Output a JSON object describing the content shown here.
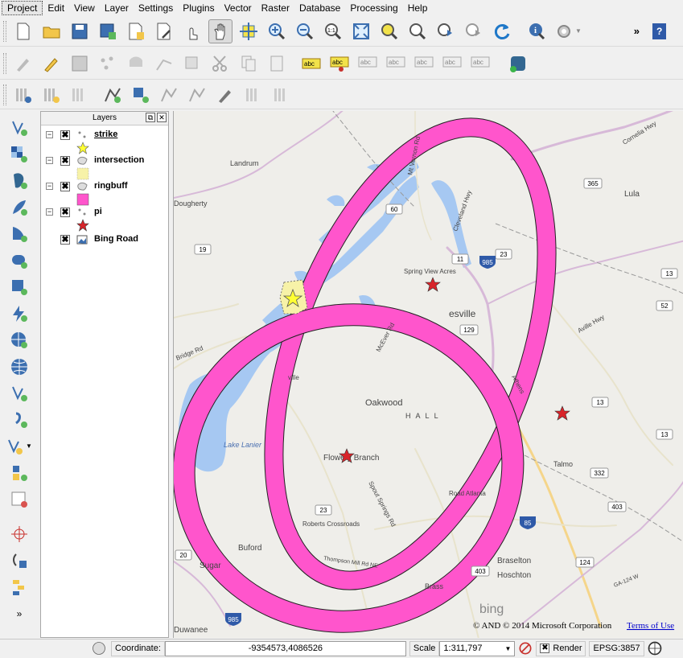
{
  "menu": [
    "Project",
    "Edit",
    "View",
    "Layer",
    "Settings",
    "Plugins",
    "Vector",
    "Raster",
    "Database",
    "Processing",
    "Help"
  ],
  "toolbar": {
    "overflow_label": "»"
  },
  "layers_panel": {
    "title": "Layers",
    "layers": [
      {
        "name": "strike",
        "checked": "✖",
        "expanded": "−",
        "symbol": "yellow-star"
      },
      {
        "name": "intersection",
        "checked": "✖",
        "expanded": "−",
        "symbol": "light-yellow-polygon"
      },
      {
        "name": "ringbuff",
        "checked": "✖",
        "expanded": "−",
        "symbol": "magenta-polygon"
      },
      {
        "name": "pi",
        "checked": "✖",
        "expanded": "−",
        "symbol": "red-star"
      },
      {
        "name": "Bing Road",
        "checked": "✖",
        "symbol": "raster"
      }
    ]
  },
  "map": {
    "place_labels": [
      "Landrum",
      "Dougherty",
      "Spring View Acres",
      "Oakwood",
      "H A L L",
      "Lake Lanier",
      "Flowery Branch",
      "Roberts Crossroads",
      "Buford",
      "Sugar",
      "Talmo",
      "Lula",
      "Braselton",
      "Hoschton",
      "Road Atlanta",
      "Bridge Rd",
      "Mt Vernon Rd",
      "Cleveland Hwy",
      "McEver Rd",
      "Spout Springs Rd",
      "Thompson Mill Rd NE",
      "Cornelia Hwy",
      "Athens",
      "Duwanee",
      "Brass",
      "esville",
      "Aville Hwy",
      "GA-124 W",
      "ville"
    ],
    "road_shields": [
      "365",
      "60",
      "11",
      "23",
      "985",
      "19",
      "52",
      "332",
      "403",
      "23",
      "85",
      "124",
      "129",
      "13",
      "20",
      "985",
      "403",
      "13",
      "13"
    ],
    "attribution": "© AND © 2014 Microsoft Corporation",
    "terms_link": "Terms of Use",
    "bing_logo": "bing",
    "colors": {
      "ring": "#ff55cc",
      "intersection": "#f7f2a8",
      "water": "#a6c8f2",
      "land": "#efeeea"
    }
  },
  "status": {
    "coordinate_label": "Coordinate:",
    "coordinate_value": "-9354573,4086526",
    "scale_label": "Scale",
    "scale_value": "1:311,797",
    "render_label": "Render",
    "render_checked": "✖",
    "crs": "EPSG:3857"
  }
}
